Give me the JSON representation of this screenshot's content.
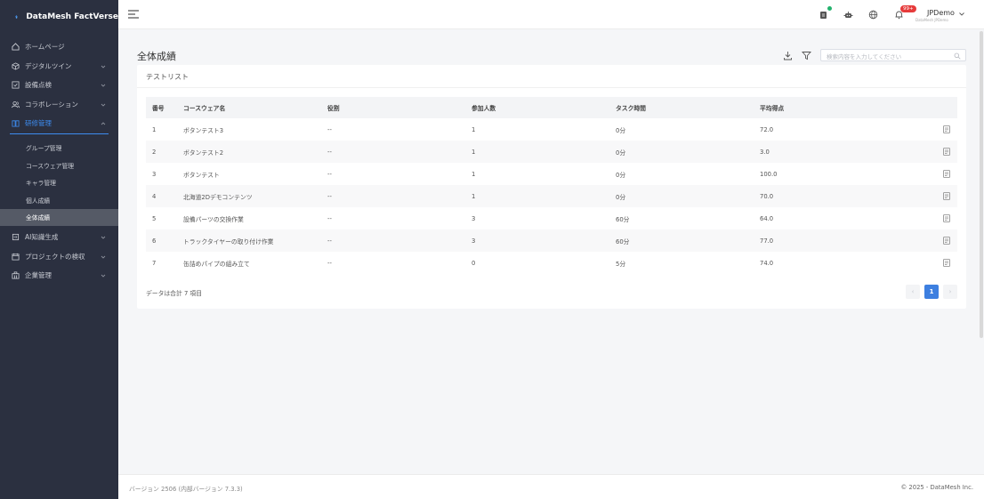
{
  "brand": {
    "name": "DataMesh FactVerse"
  },
  "sidebar": {
    "items": [
      {
        "label": "ホームページ",
        "icon": "home-icon",
        "expandable": false
      },
      {
        "label": "デジタルツイン",
        "icon": "cube-icon",
        "expandable": true
      },
      {
        "label": "設備点検",
        "icon": "checklist-icon",
        "expandable": true
      },
      {
        "label": "コラボレーション",
        "icon": "users-icon",
        "expandable": true
      },
      {
        "label": "研修管理",
        "icon": "book-icon",
        "expandable": true,
        "open": true
      }
    ],
    "sub_items": [
      {
        "label": "グループ管理"
      },
      {
        "label": "コースウェア管理"
      },
      {
        "label": "キャラ管理"
      },
      {
        "label": "個人成績"
      },
      {
        "label": "全体成績",
        "active": true
      }
    ],
    "items_after": [
      {
        "label": "AI知識生成",
        "icon": "ai-icon"
      },
      {
        "label": "プロジェクトの検収",
        "icon": "calendar-icon"
      },
      {
        "label": "企業管理",
        "icon": "building-icon"
      }
    ]
  },
  "header": {
    "notification_count": "99+",
    "user_name": "JPDemo",
    "user_subtitle": "DataMesh JPDemo"
  },
  "main": {
    "page_title": "全体成績",
    "search_placeholder": "検索内容を入力してください",
    "card_title": "テストリスト",
    "columns": [
      "番号",
      "コースウェア名",
      "役割",
      "参加人数",
      "タスク時間",
      "平均得点"
    ],
    "rows": [
      [
        "1",
        "ボタンテスト3",
        "--",
        "1",
        "0分",
        "72.0"
      ],
      [
        "2",
        "ボタンテスト2",
        "--",
        "1",
        "0分",
        "3.0"
      ],
      [
        "3",
        "ボタンテスト",
        "--",
        "1",
        "0分",
        "100.0"
      ],
      [
        "4",
        "北海道2Dデモコンテンツ",
        "--",
        "1",
        "0分",
        "70.0"
      ],
      [
        "5",
        "設備パーツの交換作業",
        "--",
        "3",
        "60分",
        "64.0"
      ],
      [
        "6",
        "トラックタイヤーの取り付け作業",
        "--",
        "3",
        "60分",
        "77.0"
      ],
      [
        "7",
        "缶詰めパイプの組み立て",
        "--",
        "0",
        "5分",
        "74.0"
      ]
    ],
    "total_text": "データは合計 7 項目",
    "pagination": {
      "prev": "‹",
      "current": "1",
      "next": "›"
    }
  },
  "footer": {
    "version": "バージョン 2506 (内部バージョン 7.3.3)",
    "copyright": "© 2025 - DataMesh Inc."
  },
  "colors": {
    "sidebar_bg": "#2b3040",
    "accent": "#3d7fe0",
    "badge": "#e63b3b",
    "status_dot": "#23b26d"
  }
}
